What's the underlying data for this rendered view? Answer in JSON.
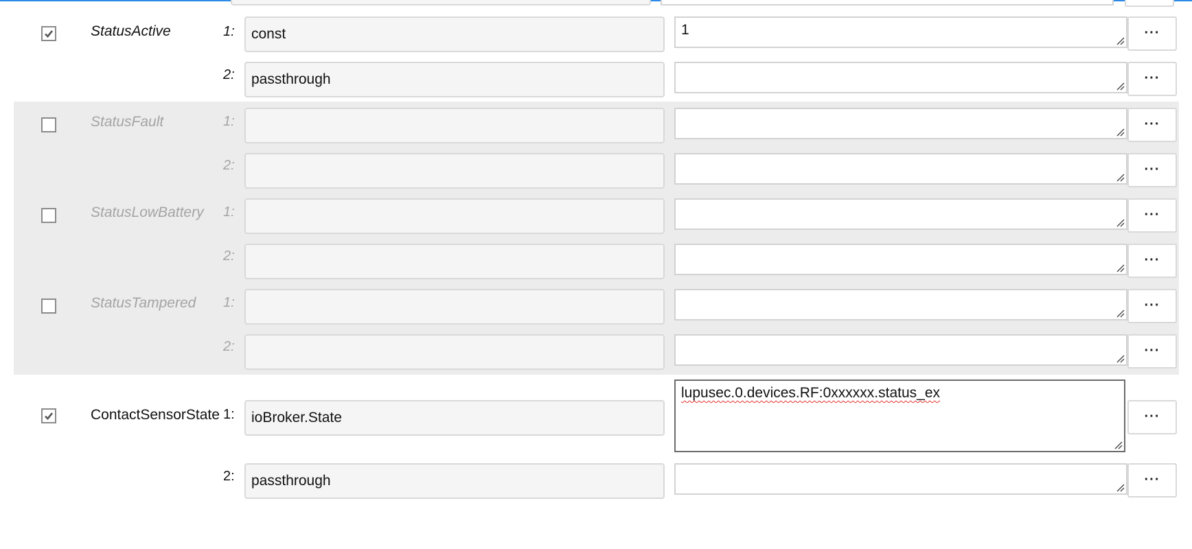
{
  "fields": [
    {
      "name": "StatusActive",
      "checked": true,
      "style": "italic",
      "disabled": false,
      "rows": [
        {
          "num": "1:",
          "input": "const",
          "value": ""
        },
        {
          "num": "2:",
          "input": "passthrough",
          "value": ""
        }
      ],
      "extra_value": "1"
    },
    {
      "name": "StatusFault",
      "checked": false,
      "rows": [
        {
          "num": "1:",
          "input": "",
          "value": ""
        },
        {
          "num": "2:",
          "input": "",
          "value": ""
        }
      ]
    },
    {
      "name": "StatusLowBattery",
      "checked": false,
      "rows": [
        {
          "num": "1:",
          "input": "",
          "value": ""
        },
        {
          "num": "2:",
          "input": "",
          "value": ""
        }
      ]
    },
    {
      "name": "StatusTampered",
      "checked": false,
      "rows": [
        {
          "num": "1:",
          "input": "",
          "value": ""
        },
        {
          "num": "2:",
          "input": "",
          "value": ""
        }
      ]
    },
    {
      "name": "ContactSensorState",
      "checked": true,
      "rows": [
        {
          "num": "1:",
          "input": "ioBroker.State",
          "value": "lupusec.0.devices.RF:0xxxxxx.status_ex"
        },
        {
          "num": "2:",
          "input": "passthrough",
          "value": ""
        }
      ]
    }
  ],
  "more_button_label": "···",
  "colors": {
    "accent_line": "#2b8ae8",
    "inactive_bg": "#ececec",
    "spellcheck": "#e0322c"
  }
}
